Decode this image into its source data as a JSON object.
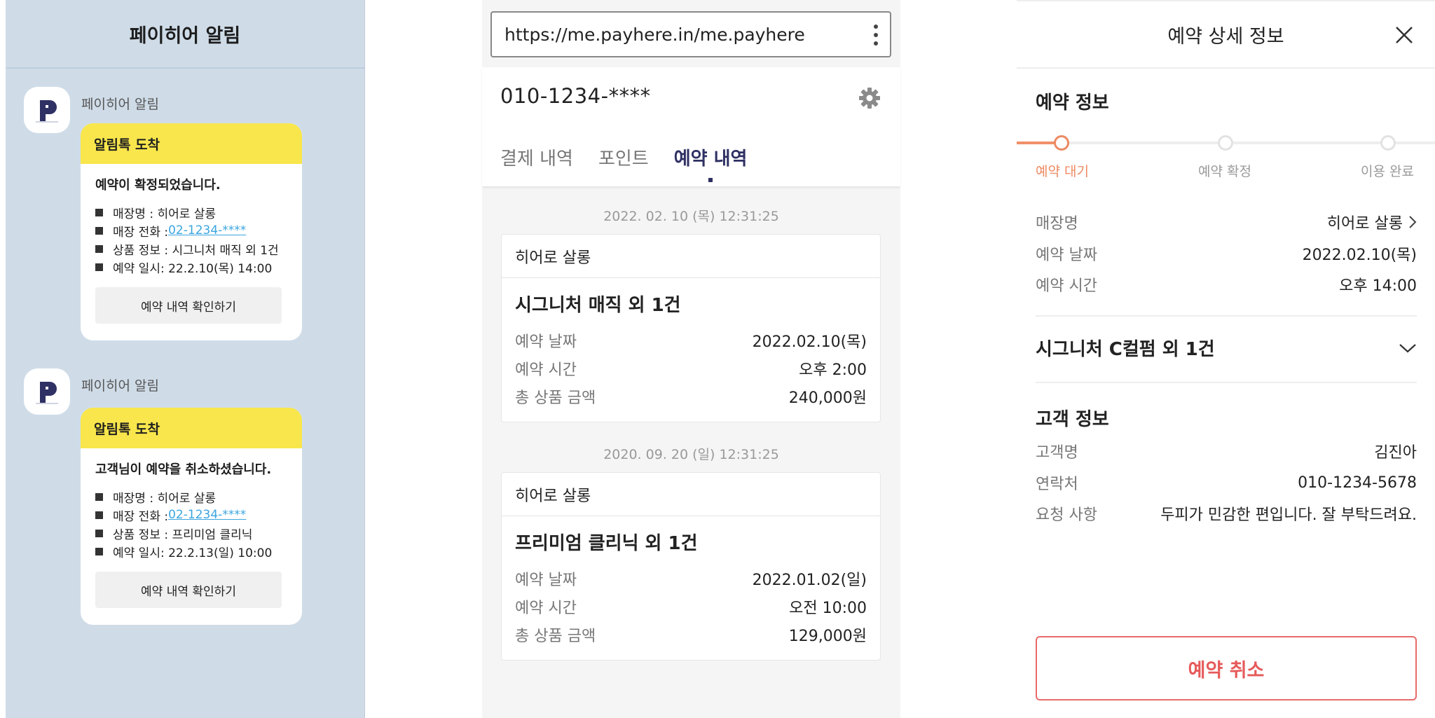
{
  "notif": {
    "title": "페이히어 알림",
    "messages": [
      {
        "sender": "페이히어 알림",
        "header": "알림톡 도착",
        "lead": "예약이 확정되었습니다.",
        "store_name": "매장명 : 히어로 살롱",
        "phone_label": "매장 전화 : ",
        "phone_link": "02-1234-****",
        "product": "상품 정보 : 시그니처 매직 외 1건",
        "datetime": "예약 일시: 22.2.10(목) 14:00",
        "button": "예약 내역 확인하기"
      },
      {
        "sender": "페이히어 알림",
        "header": "알림톡 도착",
        "lead": "고객님이 예약을 취소하셨습니다.",
        "store_name": "매장명 : 히어로 살롱",
        "phone_label": "매장 전화 : ",
        "phone_link": "02-1234-****",
        "product": "상품 정보 : 프리미엄 클리닉",
        "datetime": "예약 일시: 22.2.13(일) 10:00",
        "button": "예약 내역 확인하기"
      }
    ]
  },
  "web": {
    "url": "https://me.payhere.in/me.payhere",
    "phone": "010-1234-****",
    "tabs": [
      "결제 내역",
      "포인트",
      "예약 내역"
    ],
    "active_tab": "예약 내역",
    "reservations": [
      {
        "timestamp": "2022. 02. 10 (목) 12:31:25",
        "store": "히어로 살롱",
        "title": "시그니처 매직 외 1건",
        "rows": [
          {
            "k": "예약 날짜",
            "v": "2022.02.10(목)"
          },
          {
            "k": "예약 시간",
            "v": "오후 2:00"
          },
          {
            "k": "총 상품 금액",
            "v": "240,000원"
          }
        ]
      },
      {
        "timestamp": "2020. 09. 20 (일) 12:31:25",
        "store": "히어로 살롱",
        "title": "프리미엄 클리닉 외 1건",
        "rows": [
          {
            "k": "예약 날짜",
            "v": "2022.01.02(일)"
          },
          {
            "k": "예약 시간",
            "v": "오전 10:00"
          },
          {
            "k": "총 상품 금액",
            "v": "129,000원"
          }
        ]
      }
    ]
  },
  "detail": {
    "title": "예약 상세 정보",
    "section_reservation": "예약 정보",
    "steps": [
      "예약 대기",
      "예약 확정",
      "이용 완료"
    ],
    "active_step": "예약 대기",
    "info": [
      {
        "k": "매장명",
        "v": "히어로 살롱"
      },
      {
        "k": "예약 날짜",
        "v": "2022.02.10(목)"
      },
      {
        "k": "예약 시간",
        "v": "오후 14:00"
      }
    ],
    "product": "시그니처 C컬펌 외 1건",
    "section_customer": "고객 정보",
    "customer": [
      {
        "k": "고객명",
        "v": "김진아"
      },
      {
        "k": "연락처",
        "v": "010-1234-5678"
      },
      {
        "k": "요청 사항",
        "v": "두피가 민감한 편입니다. 잘 부탁드려요."
      }
    ],
    "cancel": "예약 취소"
  },
  "colors": {
    "notif_bg": "#cfdce8",
    "kakao_yellow": "#f8e64c",
    "brand_navy": "#2f3063",
    "step_active": "#ee8a62",
    "cancel_red": "#e65a5a",
    "link_blue": "#3aa5df"
  },
  "icons": {
    "app_logo": "payhere-logo-icon",
    "menu": "kebab-menu-icon",
    "settings": "gear-icon",
    "close": "close-icon",
    "chevron_right": "chevron-right-icon",
    "chevron_down": "chevron-down-icon"
  }
}
